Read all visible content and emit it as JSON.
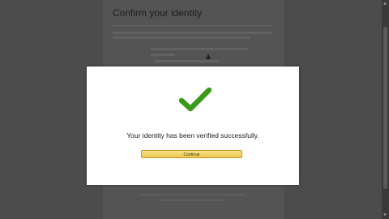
{
  "page": {
    "title": "Confirm your identity"
  },
  "modal": {
    "message": "Your identity has been verified successfully.",
    "continue_label": "Continue",
    "check_color": "#3a9a1a"
  },
  "colors": {
    "overlay": "#4c4c4c",
    "button": "#f0c850"
  }
}
